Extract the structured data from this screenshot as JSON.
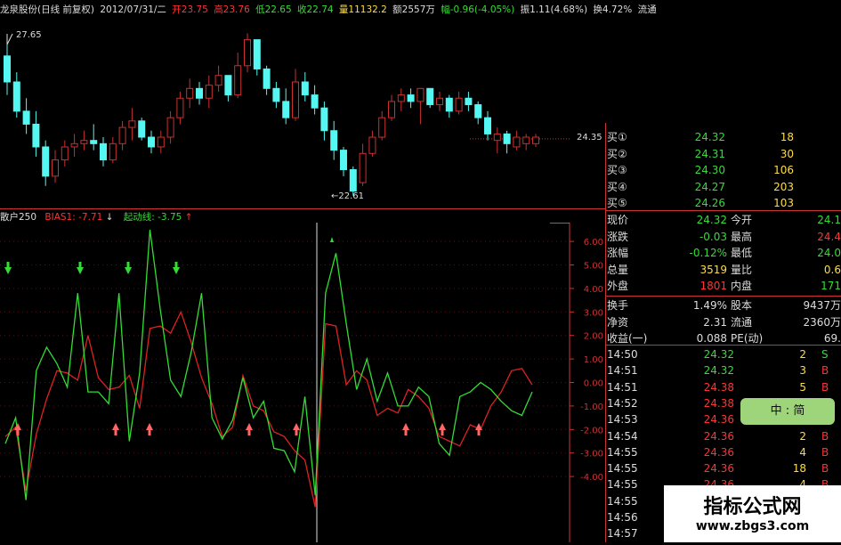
{
  "header": {
    "name": "龙泉股份(日线 前复权)",
    "date": "2012/07/31/二",
    "open": "开23.75",
    "high": "高23.76",
    "low": "低22.65",
    "close": "收22.74",
    "volume": "量11132.2",
    "amount": "额2557万",
    "change": "幅-0.96(-4.05%)",
    "amplitude": "振1.11(4.68%)",
    "turnover": "换4.72%",
    "flow": "流通"
  },
  "price_chart": {
    "high_label": "27.65",
    "low_label": "←22.61",
    "last_label": "24.35",
    "candles": [
      [
        26.9,
        27.4,
        25.7,
        26.1
      ],
      [
        26.1,
        26.4,
        25.0,
        25.2
      ],
      [
        25.2,
        25.6,
        24.5,
        24.8
      ],
      [
        24.8,
        25.2,
        23.8,
        24.1
      ],
      [
        24.1,
        24.3,
        22.9,
        23.2
      ],
      [
        23.2,
        24.0,
        23.0,
        23.7
      ],
      [
        23.7,
        24.3,
        23.5,
        24.1
      ],
      [
        24.1,
        24.5,
        23.8,
        24.2
      ],
      [
        24.2,
        24.6,
        24.0,
        24.3
      ],
      [
        24.3,
        24.8,
        24.0,
        24.2
      ],
      [
        24.2,
        24.4,
        23.5,
        23.7
      ],
      [
        23.7,
        24.4,
        23.6,
        24.2
      ],
      [
        24.2,
        24.9,
        24.0,
        24.7
      ],
      [
        24.7,
        25.3,
        24.3,
        24.9
      ],
      [
        24.9,
        25.0,
        24.3,
        24.4
      ],
      [
        24.4,
        24.6,
        23.9,
        24.1
      ],
      [
        24.1,
        24.6,
        23.9,
        24.4
      ],
      [
        24.4,
        25.2,
        24.2,
        25.0
      ],
      [
        25.0,
        25.8,
        24.8,
        25.6
      ],
      [
        25.6,
        26.2,
        25.3,
        25.9
      ],
      [
        25.9,
        26.1,
        25.4,
        25.6
      ],
      [
        25.6,
        26.3,
        25.3,
        26.0
      ],
      [
        26.0,
        26.6,
        25.8,
        26.3
      ],
      [
        26.3,
        26.2,
        25.5,
        25.7
      ],
      [
        25.7,
        27.0,
        25.6,
        26.6
      ],
      [
        26.6,
        27.6,
        26.4,
        27.4
      ],
      [
        27.4,
        27.4,
        26.3,
        26.5
      ],
      [
        26.5,
        26.6,
        25.7,
        25.9
      ],
      [
        25.9,
        26.1,
        25.3,
        25.5
      ],
      [
        25.5,
        25.9,
        24.8,
        25.0
      ],
      [
        25.0,
        26.5,
        24.9,
        26.1
      ],
      [
        26.1,
        26.4,
        25.5,
        25.7
      ],
      [
        25.7,
        26.0,
        25.1,
        25.3
      ],
      [
        25.3,
        25.5,
        24.3,
        24.6
      ],
      [
        24.6,
        24.9,
        23.7,
        24.0
      ],
      [
        24.0,
        24.1,
        23.2,
        23.4
      ],
      [
        23.4,
        23.5,
        22.6,
        22.74
      ],
      [
        23.0,
        24.2,
        22.9,
        23.9
      ],
      [
        23.9,
        24.6,
        23.8,
        24.4
      ],
      [
        24.4,
        25.2,
        24.3,
        25.0
      ],
      [
        25.0,
        25.7,
        24.9,
        25.5
      ],
      [
        25.5,
        25.9,
        25.2,
        25.7
      ],
      [
        25.7,
        25.9,
        25.3,
        25.5
      ],
      [
        25.5,
        25.8,
        24.8,
        25.9
      ],
      [
        25.9,
        25.9,
        25.3,
        25.4
      ],
      [
        25.4,
        25.8,
        25.2,
        25.6
      ],
      [
        25.6,
        25.7,
        25.0,
        25.2
      ],
      [
        25.2,
        25.8,
        25.1,
        25.6
      ],
      [
        25.6,
        25.8,
        25.2,
        25.4
      ],
      [
        25.4,
        25.5,
        24.8,
        25.0
      ],
      [
        25.0,
        25.2,
        24.3,
        24.5
      ],
      [
        24.3,
        24.7,
        23.9,
        24.5
      ],
      [
        24.5,
        24.6,
        23.9,
        24.2
      ],
      [
        24.1,
        24.6,
        24.0,
        24.4
      ],
      [
        24.2,
        24.5,
        24.0,
        24.4
      ],
      [
        24.2,
        24.5,
        24.1,
        24.4
      ]
    ]
  },
  "indicator": {
    "name": "散户250",
    "bias_label": "BIAS1: -7.71",
    "bias_arrow": "↓",
    "start_label": "起动线: -3.75",
    "start_arrow": "↑",
    "axis_ticks": [
      "6.00",
      "5.00",
      "4.00",
      "3.00",
      "2.00",
      "1.00",
      "0.00",
      "-1.00",
      "-2.00",
      "-3.00",
      "-4.00"
    ],
    "tick_values": [
      6,
      5,
      4,
      3,
      2,
      1,
      0,
      -1,
      -2,
      -3,
      -4
    ],
    "green_series": [
      -2.6,
      -1.5,
      -5.0,
      0.5,
      1.5,
      0.8,
      -0.2,
      3.8,
      -0.4,
      -0.4,
      -0.9,
      3.8,
      -2.5,
      0.4,
      6.5,
      3.1,
      0.1,
      -0.6,
      1.3,
      3.8,
      -1.5,
      -2.4,
      -1.6,
      0.2,
      -1.5,
      -0.8,
      -2.8,
      -2.9,
      -3.8,
      -0.6,
      -4.8,
      3.8,
      5.5,
      2.5,
      -0.3,
      1.0,
      -0.8,
      0.4,
      -1.0,
      -1.0,
      -0.2,
      -0.6,
      -2.6,
      -3.1,
      -0.6,
      -0.4,
      0.0,
      -0.3,
      -0.8,
      -1.2,
      -1.4,
      -0.4
    ],
    "red_series": [
      -2.3,
      -1.9,
      -4.6,
      -2.2,
      -0.7,
      0.5,
      0.4,
      0.1,
      2.0,
      0.2,
      -0.3,
      -0.2,
      0.3,
      -1.1,
      2.3,
      2.4,
      2.1,
      3.0,
      1.7,
      0.2,
      -0.9,
      -2.3,
      -1.9,
      0.3,
      -1.0,
      -1.2,
      -2.1,
      -2.3,
      -2.9,
      -3.3,
      -5.3,
      2.5,
      2.4,
      -0.1,
      0.5,
      0.1,
      -1.4,
      -1.1,
      -1.3,
      -0.3,
      -0.6,
      -1.1,
      -2.3,
      -2.5,
      -2.7,
      -1.8,
      -2.0,
      -1.0,
      -0.4,
      0.5,
      0.6,
      -0.1
    ],
    "down_arrows_at": [
      0,
      7,
      11,
      14
    ],
    "up_arrows_at": [
      1,
      9,
      12,
      22,
      26,
      36,
      39,
      43
    ]
  },
  "quote": {
    "buy": [
      {
        "label": "买①",
        "price": "24.32",
        "vol": "18"
      },
      {
        "label": "买②",
        "price": "24.31",
        "vol": "30"
      },
      {
        "label": "买③",
        "price": "24.30",
        "vol": "106"
      },
      {
        "label": "买④",
        "price": "24.27",
        "vol": "203"
      },
      {
        "label": "买⑤",
        "price": "24.26",
        "vol": "103"
      }
    ],
    "stats": [
      {
        "l1": "现价",
        "v1": "24.32",
        "c1": "#33dd33",
        "l2": "今开",
        "v2": "24.1",
        "c2": "#33dd33"
      },
      {
        "l1": "涨跌",
        "v1": "-0.03",
        "c1": "#33dd33",
        "l2": "最高",
        "v2": "24.4",
        "c2": "#ff3333"
      },
      {
        "l1": "涨幅",
        "v1": "-0.12%",
        "c1": "#33dd33",
        "l2": "最低",
        "v2": "24.0",
        "c2": "#33dd33"
      },
      {
        "l1": "总量",
        "v1": "3519",
        "c1": "#ffdd44",
        "l2": "量比",
        "v2": "0.6",
        "c2": "#ffdd44"
      },
      {
        "l1": "外盘",
        "v1": "1801",
        "c1": "#ff3333",
        "l2": "内盘",
        "v2": "171",
        "c2": "#33dd33"
      }
    ],
    "fundamentals": [
      {
        "l1": "换手",
        "v1": "1.49%",
        "l2": "股本",
        "v2": "9437万"
      },
      {
        "l1": "净资",
        "v1": "2.31",
        "l2": "流通",
        "v2": "2360万"
      },
      {
        "l1": "收益(一)",
        "v1": "0.088",
        "l2": "PE(动)",
        "v2": "69."
      }
    ],
    "ticks": [
      {
        "time": "14:50",
        "price": "24.32",
        "pc": "#33dd33",
        "vol": "2",
        "side": "S",
        "sc": "#33dd33"
      },
      {
        "time": "14:51",
        "price": "24.32",
        "pc": "#33dd33",
        "vol": "3",
        "side": "B",
        "sc": "#ff3333"
      },
      {
        "time": "14:51",
        "price": "24.38",
        "pc": "#ff3333",
        "vol": "5",
        "side": "B",
        "sc": "#ff3333"
      },
      {
        "time": "14:52",
        "price": "24.38",
        "pc": "#ff3333",
        "vol": "",
        "side": "",
        "sc": "#ff3333"
      },
      {
        "time": "14:53",
        "price": "24.36",
        "pc": "#ff3333",
        "vol": "",
        "side": "",
        "sc": "#ff3333"
      },
      {
        "time": "14:54",
        "price": "24.36",
        "pc": "#ff3333",
        "vol": "2",
        "side": "B",
        "sc": "#ff3333"
      },
      {
        "time": "14:55",
        "price": "24.36",
        "pc": "#ff3333",
        "vol": "4",
        "side": "B",
        "sc": "#ff3333"
      },
      {
        "time": "14:55",
        "price": "24.36",
        "pc": "#ff3333",
        "vol": "18",
        "side": "B",
        "sc": "#ff3333"
      },
      {
        "time": "14:55",
        "price": "24.36",
        "pc": "#ff3333",
        "vol": "4",
        "side": "B",
        "sc": "#ff3333"
      },
      {
        "time": "14:55",
        "price": "",
        "pc": "#ff3333",
        "vol": "",
        "side": "",
        "sc": "#ff3333"
      },
      {
        "time": "14:56",
        "price": "",
        "pc": "#ff3333",
        "vol": "",
        "side": "",
        "sc": "#ff3333"
      },
      {
        "time": "14:57",
        "price": "",
        "pc": "#ff3333",
        "vol": "",
        "side": "",
        "sc": "#ff3333"
      }
    ]
  },
  "badge": {
    "text": "中 : 简"
  },
  "watermark": {
    "title": "指标公式网",
    "url": "www.zbgs3.com"
  },
  "colors": {
    "up": "#c8312e",
    "down": "#54f7f2",
    "green": "#33dd33",
    "red": "#ff3333",
    "yellow": "#ffdd44",
    "axis": "#c33"
  }
}
